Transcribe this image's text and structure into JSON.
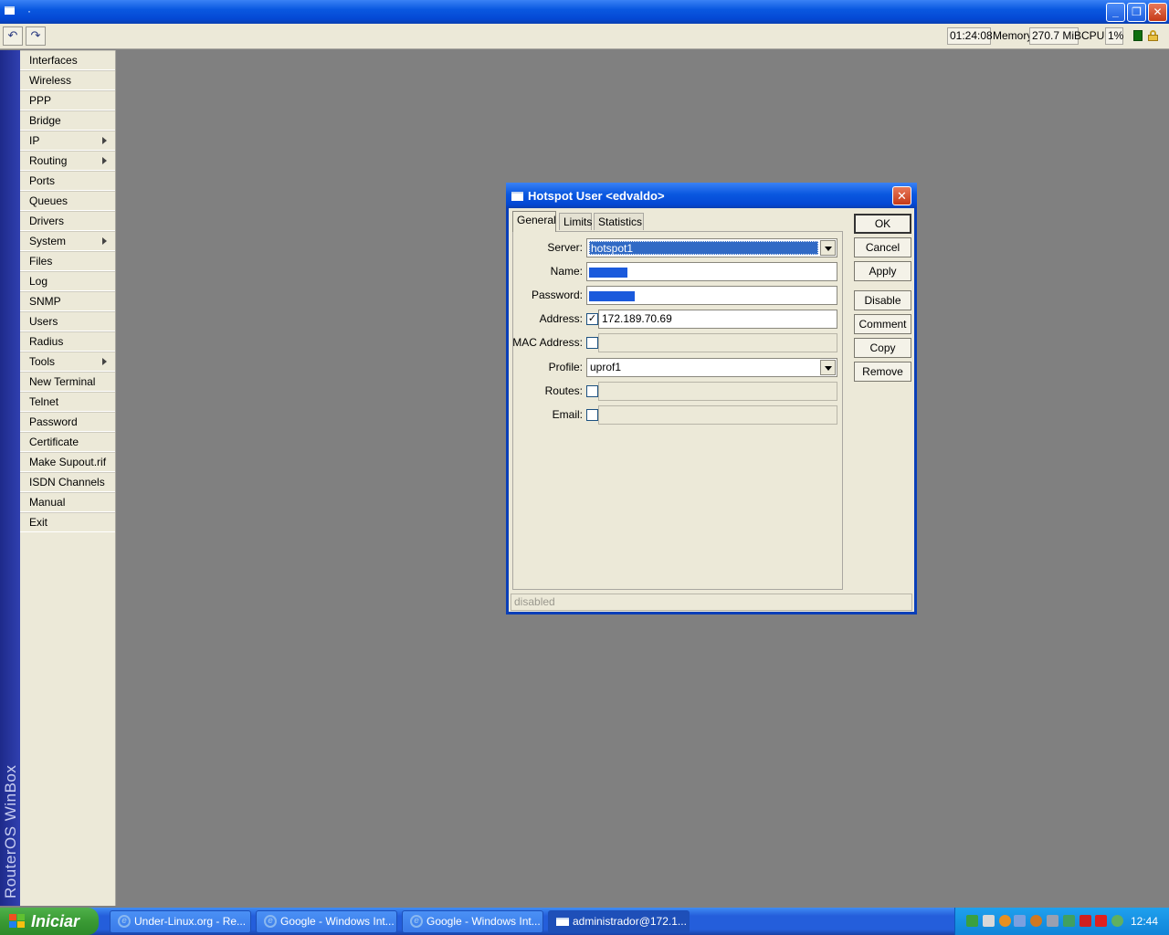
{
  "window": {
    "title": "·"
  },
  "toolbar": {
    "uptime": "01:24:08",
    "memory_label": "Memory:",
    "memory_value": "270.7 MiB",
    "cpu_label": "CPU:",
    "cpu_value": "1%"
  },
  "sidebar": {
    "brand": "RouterOS WinBox",
    "items": [
      {
        "label": "Interfaces",
        "submenu": false
      },
      {
        "label": "Wireless",
        "submenu": false
      },
      {
        "label": "PPP",
        "submenu": false
      },
      {
        "label": "Bridge",
        "submenu": false
      },
      {
        "label": "IP",
        "submenu": true
      },
      {
        "label": "Routing",
        "submenu": true
      },
      {
        "label": "Ports",
        "submenu": false
      },
      {
        "label": "Queues",
        "submenu": false
      },
      {
        "label": "Drivers",
        "submenu": false
      },
      {
        "label": "System",
        "submenu": true
      },
      {
        "label": "Files",
        "submenu": false
      },
      {
        "label": "Log",
        "submenu": false
      },
      {
        "label": "SNMP",
        "submenu": false
      },
      {
        "label": "Users",
        "submenu": false
      },
      {
        "label": "Radius",
        "submenu": false
      },
      {
        "label": "Tools",
        "submenu": true
      },
      {
        "label": "New Terminal",
        "submenu": false
      },
      {
        "label": "Telnet",
        "submenu": false
      },
      {
        "label": "Password",
        "submenu": false
      },
      {
        "label": "Certificate",
        "submenu": false
      },
      {
        "label": "Make Supout.rif",
        "submenu": false
      },
      {
        "label": "ISDN Channels",
        "submenu": false
      },
      {
        "label": "Manual",
        "submenu": false
      },
      {
        "label": "Exit",
        "submenu": false
      }
    ]
  },
  "dialog": {
    "title": "Hotspot User <edvaldo>",
    "tabs": [
      "General",
      "Limits",
      "Statistics"
    ],
    "active_tab": "General",
    "fields": {
      "server_label": "Server:",
      "server_value": "hotspot1",
      "name_label": "Name:",
      "password_label": "Password:",
      "address_label": "Address:",
      "address_checked": true,
      "address_value": "172.189.70.69",
      "mac_label": "MAC Address:",
      "mac_checked": false,
      "mac_value": "",
      "profile_label": "Profile:",
      "profile_value": "uprof1",
      "routes_label": "Routes:",
      "routes_checked": false,
      "routes_value": "",
      "email_label": "Email:",
      "email_checked": false,
      "email_value": ""
    },
    "buttons": {
      "ok": "OK",
      "cancel": "Cancel",
      "apply": "Apply",
      "disable": "Disable",
      "comment": "Comment",
      "copy": "Copy",
      "remove": "Remove"
    },
    "status": "disabled"
  },
  "taskbar": {
    "start_label": "Iniciar",
    "tasks": [
      {
        "label": "Under-Linux.org - Re...",
        "icon": "ie-icon"
      },
      {
        "label": "Google - Windows Int...",
        "icon": "ie-icon"
      },
      {
        "label": "Google - Windows Int...",
        "icon": "ie-icon"
      },
      {
        "label": "administrador@172.1...",
        "icon": "winbox-icon"
      }
    ],
    "clock": "12:44"
  },
  "colors": {
    "xp_blue": "#0a58e0",
    "selection": "#316ac5",
    "sidebar_strip": "#1e2a8a",
    "face": "#ece9d8"
  }
}
